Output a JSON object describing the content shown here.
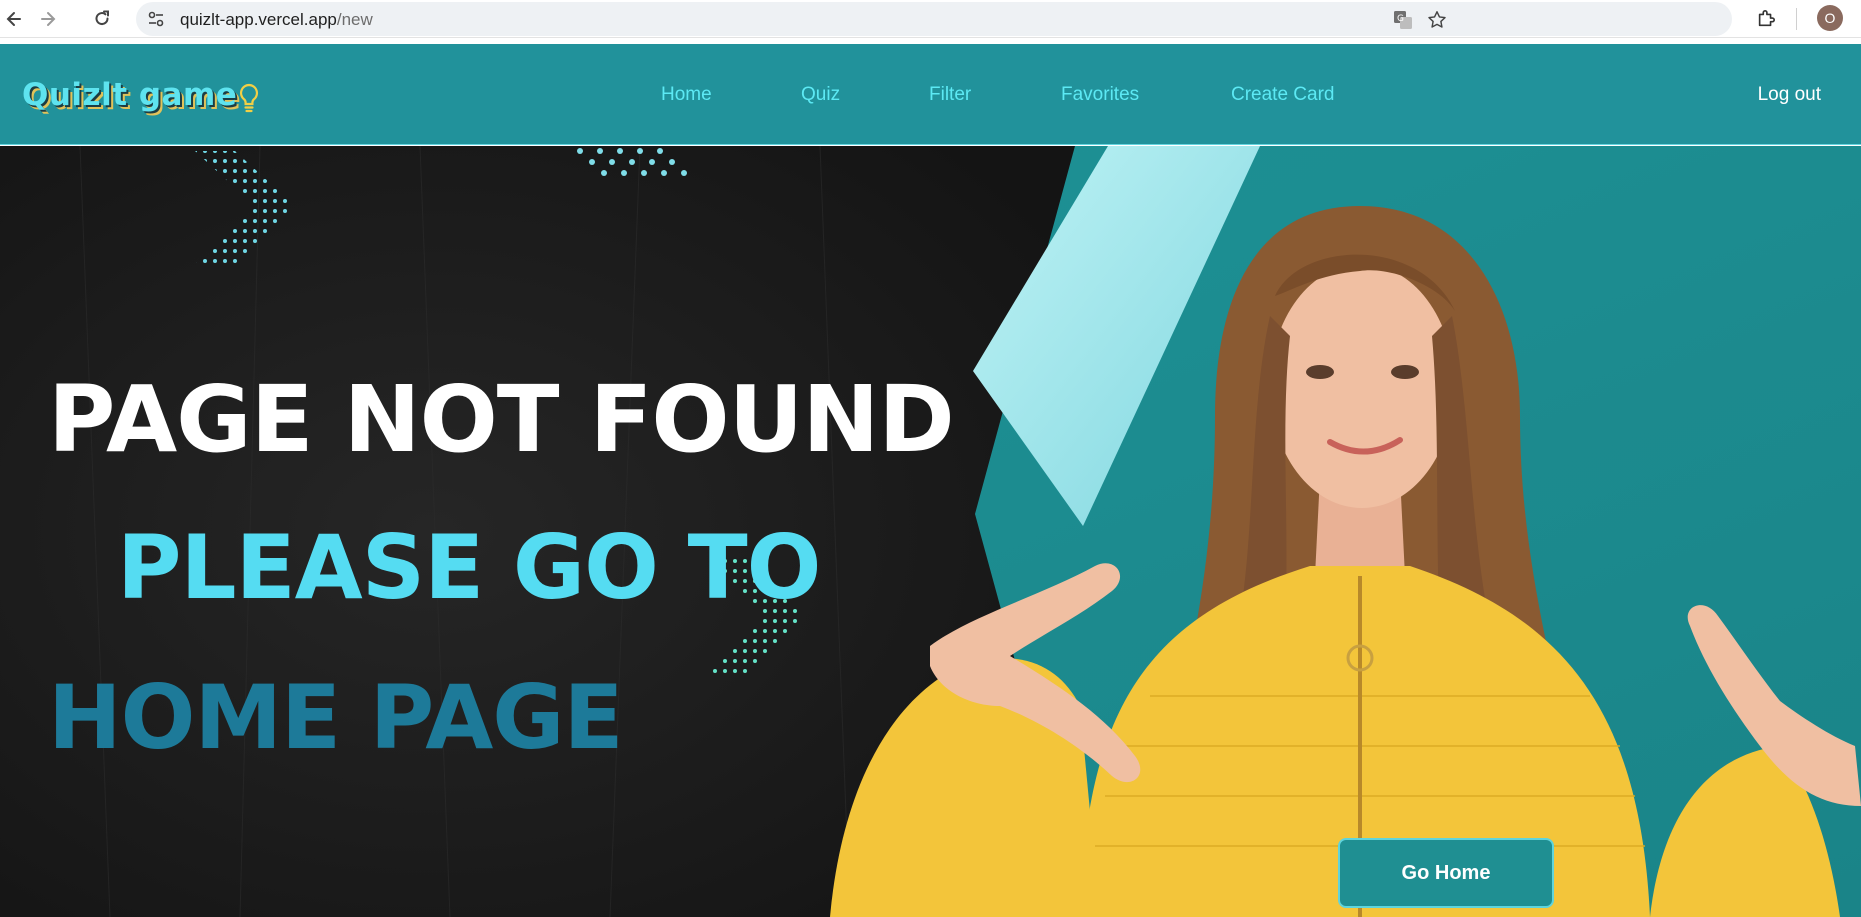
{
  "browser": {
    "url_host": "quizlt-app.vercel.app",
    "url_path": "/new",
    "profile_initial": "O"
  },
  "navbar": {
    "brand": "Quizlt game",
    "links": [
      "Home",
      "Quiz",
      "Filter",
      "Favorites",
      "Create Card"
    ],
    "logout": "Log out"
  },
  "hero": {
    "line1": "PAGE NOT FOUND",
    "line2": "PLEASE GO TO",
    "line3": "HOME PAGE",
    "button": "Go Home"
  },
  "colors": {
    "navbar_bg": "#21929b",
    "nav_link": "#5ce9f4",
    "brand_text": "#5ee3ef",
    "hero_dark": "#1c1c1c",
    "hero_teal": "#1f8f92",
    "headline_white": "#ffffff",
    "headline_cyan": "#55dcf2",
    "headline_blue": "#1d7a99"
  }
}
